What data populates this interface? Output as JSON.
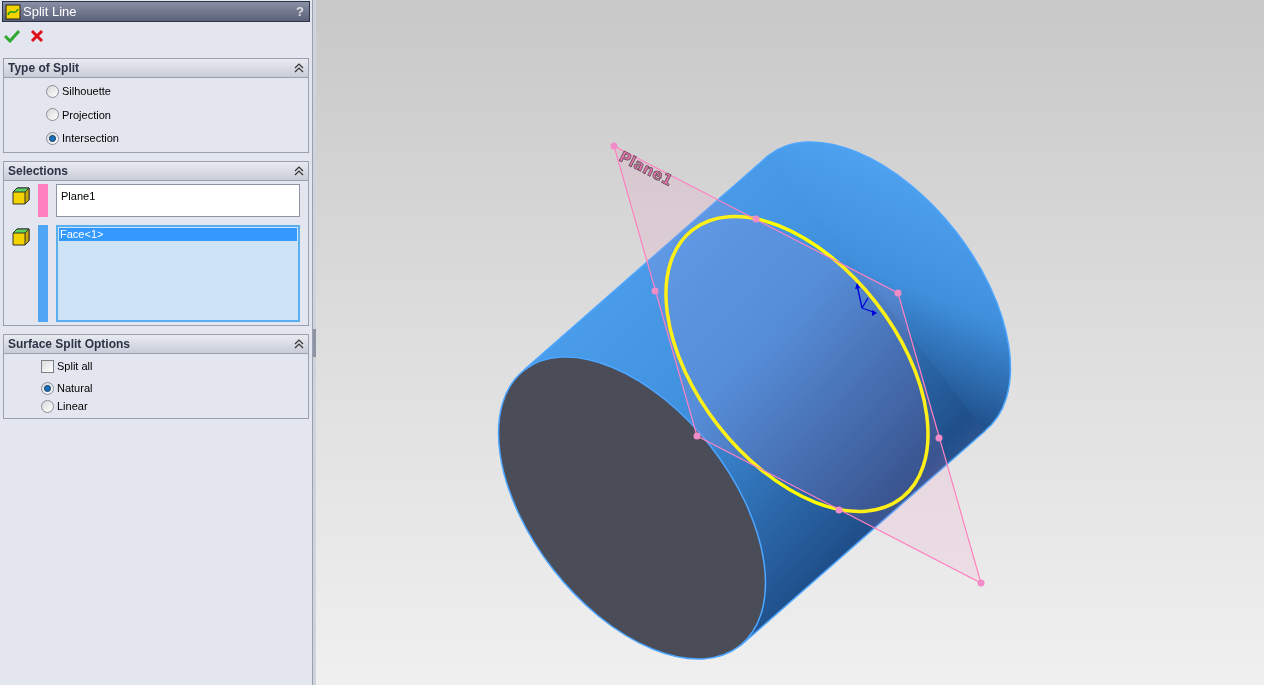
{
  "property_manager": {
    "title": "Split Line",
    "help": "?"
  },
  "sections": [
    {
      "title": "Type of Split",
      "kind": "radios",
      "options": [
        {
          "label": "Silhouette",
          "selected": false
        },
        {
          "label": "Projection",
          "selected": false
        },
        {
          "label": "Intersection",
          "selected": true
        }
      ]
    },
    {
      "title": "Selections",
      "kind": "selections",
      "boxes": [
        {
          "kind": "field",
          "value": "Plane1",
          "color": "#ff80c0",
          "focused": false
        },
        {
          "kind": "list",
          "color": "#4ea6f5",
          "focused": true,
          "items": [
            {
              "label": "Face<1>",
              "selected": true
            }
          ]
        }
      ]
    },
    {
      "title": "Surface Split Options",
      "kind": "options",
      "checkbox": {
        "label": "Split all",
        "checked": false
      },
      "options": [
        {
          "label": "Natural",
          "selected": true
        },
        {
          "label": "Linear",
          "selected": false
        }
      ]
    }
  ],
  "viewport": {
    "plane_label": "Plane1"
  }
}
